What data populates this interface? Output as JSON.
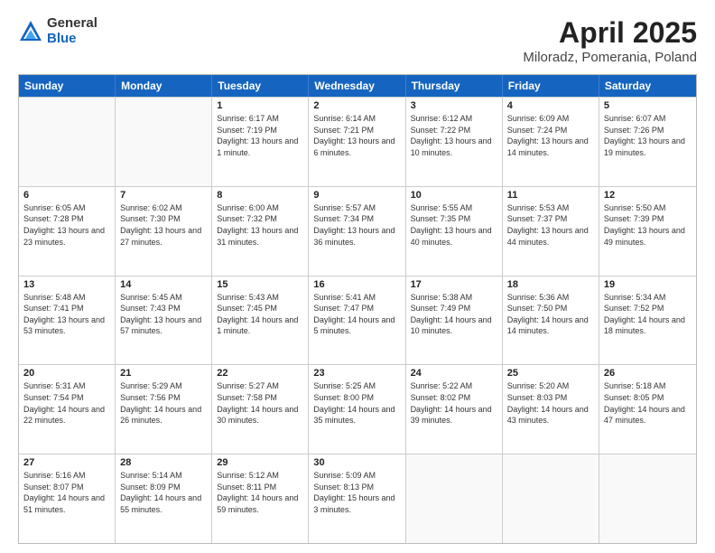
{
  "header": {
    "logo_general": "General",
    "logo_blue": "Blue",
    "title": "April 2025",
    "subtitle": "Miloradz, Pomerania, Poland"
  },
  "weekdays": [
    "Sunday",
    "Monday",
    "Tuesday",
    "Wednesday",
    "Thursday",
    "Friday",
    "Saturday"
  ],
  "weeks": [
    [
      {
        "day": "",
        "info": ""
      },
      {
        "day": "",
        "info": ""
      },
      {
        "day": "1",
        "info": "Sunrise: 6:17 AM\nSunset: 7:19 PM\nDaylight: 13 hours and 1 minute."
      },
      {
        "day": "2",
        "info": "Sunrise: 6:14 AM\nSunset: 7:21 PM\nDaylight: 13 hours and 6 minutes."
      },
      {
        "day": "3",
        "info": "Sunrise: 6:12 AM\nSunset: 7:22 PM\nDaylight: 13 hours and 10 minutes."
      },
      {
        "day": "4",
        "info": "Sunrise: 6:09 AM\nSunset: 7:24 PM\nDaylight: 13 hours and 14 minutes."
      },
      {
        "day": "5",
        "info": "Sunrise: 6:07 AM\nSunset: 7:26 PM\nDaylight: 13 hours and 19 minutes."
      }
    ],
    [
      {
        "day": "6",
        "info": "Sunrise: 6:05 AM\nSunset: 7:28 PM\nDaylight: 13 hours and 23 minutes."
      },
      {
        "day": "7",
        "info": "Sunrise: 6:02 AM\nSunset: 7:30 PM\nDaylight: 13 hours and 27 minutes."
      },
      {
        "day": "8",
        "info": "Sunrise: 6:00 AM\nSunset: 7:32 PM\nDaylight: 13 hours and 31 minutes."
      },
      {
        "day": "9",
        "info": "Sunrise: 5:57 AM\nSunset: 7:34 PM\nDaylight: 13 hours and 36 minutes."
      },
      {
        "day": "10",
        "info": "Sunrise: 5:55 AM\nSunset: 7:35 PM\nDaylight: 13 hours and 40 minutes."
      },
      {
        "day": "11",
        "info": "Sunrise: 5:53 AM\nSunset: 7:37 PM\nDaylight: 13 hours and 44 minutes."
      },
      {
        "day": "12",
        "info": "Sunrise: 5:50 AM\nSunset: 7:39 PM\nDaylight: 13 hours and 49 minutes."
      }
    ],
    [
      {
        "day": "13",
        "info": "Sunrise: 5:48 AM\nSunset: 7:41 PM\nDaylight: 13 hours and 53 minutes."
      },
      {
        "day": "14",
        "info": "Sunrise: 5:45 AM\nSunset: 7:43 PM\nDaylight: 13 hours and 57 minutes."
      },
      {
        "day": "15",
        "info": "Sunrise: 5:43 AM\nSunset: 7:45 PM\nDaylight: 14 hours and 1 minute."
      },
      {
        "day": "16",
        "info": "Sunrise: 5:41 AM\nSunset: 7:47 PM\nDaylight: 14 hours and 5 minutes."
      },
      {
        "day": "17",
        "info": "Sunrise: 5:38 AM\nSunset: 7:49 PM\nDaylight: 14 hours and 10 minutes."
      },
      {
        "day": "18",
        "info": "Sunrise: 5:36 AM\nSunset: 7:50 PM\nDaylight: 14 hours and 14 minutes."
      },
      {
        "day": "19",
        "info": "Sunrise: 5:34 AM\nSunset: 7:52 PM\nDaylight: 14 hours and 18 minutes."
      }
    ],
    [
      {
        "day": "20",
        "info": "Sunrise: 5:31 AM\nSunset: 7:54 PM\nDaylight: 14 hours and 22 minutes."
      },
      {
        "day": "21",
        "info": "Sunrise: 5:29 AM\nSunset: 7:56 PM\nDaylight: 14 hours and 26 minutes."
      },
      {
        "day": "22",
        "info": "Sunrise: 5:27 AM\nSunset: 7:58 PM\nDaylight: 14 hours and 30 minutes."
      },
      {
        "day": "23",
        "info": "Sunrise: 5:25 AM\nSunset: 8:00 PM\nDaylight: 14 hours and 35 minutes."
      },
      {
        "day": "24",
        "info": "Sunrise: 5:22 AM\nSunset: 8:02 PM\nDaylight: 14 hours and 39 minutes."
      },
      {
        "day": "25",
        "info": "Sunrise: 5:20 AM\nSunset: 8:03 PM\nDaylight: 14 hours and 43 minutes."
      },
      {
        "day": "26",
        "info": "Sunrise: 5:18 AM\nSunset: 8:05 PM\nDaylight: 14 hours and 47 minutes."
      }
    ],
    [
      {
        "day": "27",
        "info": "Sunrise: 5:16 AM\nSunset: 8:07 PM\nDaylight: 14 hours and 51 minutes."
      },
      {
        "day": "28",
        "info": "Sunrise: 5:14 AM\nSunset: 8:09 PM\nDaylight: 14 hours and 55 minutes."
      },
      {
        "day": "29",
        "info": "Sunrise: 5:12 AM\nSunset: 8:11 PM\nDaylight: 14 hours and 59 minutes."
      },
      {
        "day": "30",
        "info": "Sunrise: 5:09 AM\nSunset: 8:13 PM\nDaylight: 15 hours and 3 minutes."
      },
      {
        "day": "",
        "info": ""
      },
      {
        "day": "",
        "info": ""
      },
      {
        "day": "",
        "info": ""
      }
    ]
  ]
}
